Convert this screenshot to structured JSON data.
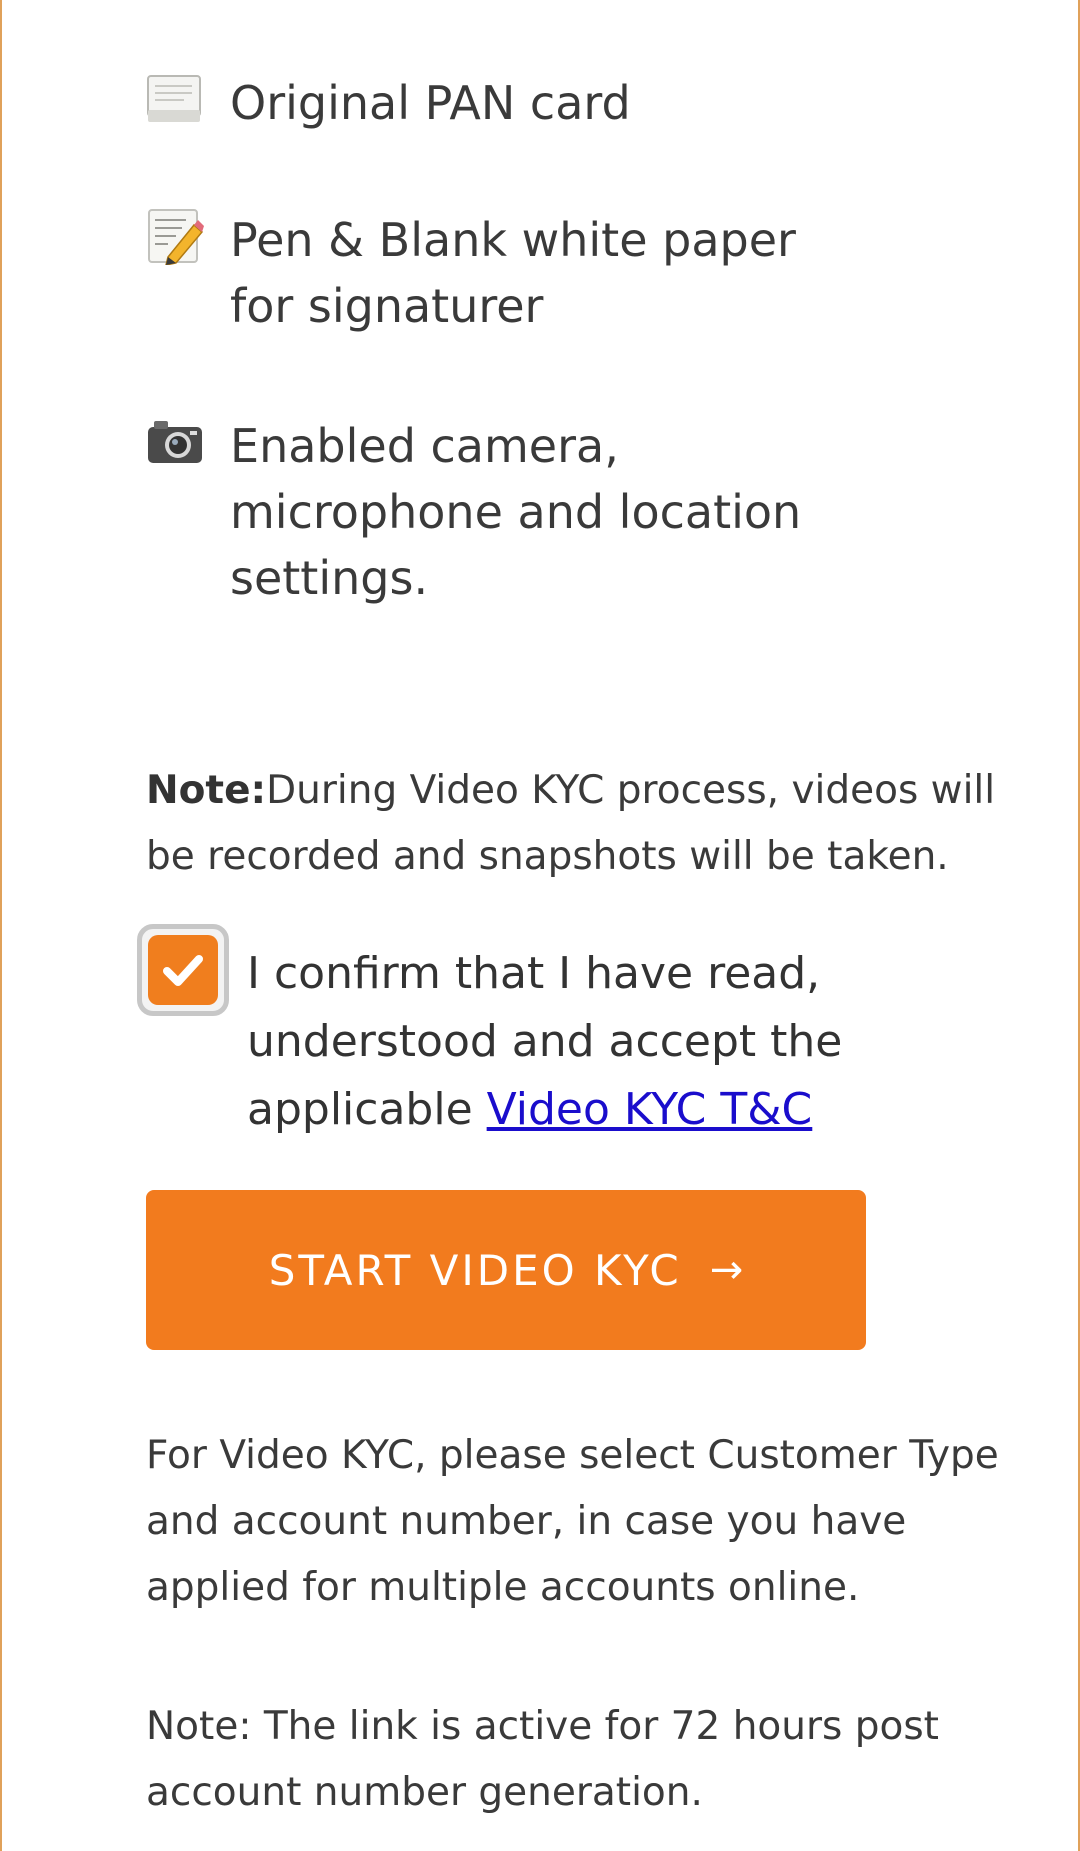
{
  "requirements": [
    {
      "icon": "pan-card-icon",
      "text": "Original PAN card"
    },
    {
      "icon": "memo-pencil-icon",
      "text": "Pen & Blank white paper for signaturer"
    },
    {
      "icon": "camera-icon",
      "text": "Enabled camera, microphone and location settings."
    }
  ],
  "note": {
    "label": "Note:",
    "text": "During Video KYC process, videos will be recorded and snapshots will be taken."
  },
  "consent": {
    "checked": true,
    "text": "I confirm that I have read, understood and accept the applicable ",
    "link_text": "Video KYC T&C"
  },
  "start_button": {
    "label": "START VIDEO KYC",
    "arrow": "→"
  },
  "info": "For Video KYC, please select Customer Type and account number, in case you have applied for multiple accounts online.",
  "link_note": "Note: The link is active for 72 hours post account number generation.",
  "colors": {
    "accent": "#F27B1E",
    "link": "#1A0DCC",
    "frame": "#E0A15A"
  }
}
